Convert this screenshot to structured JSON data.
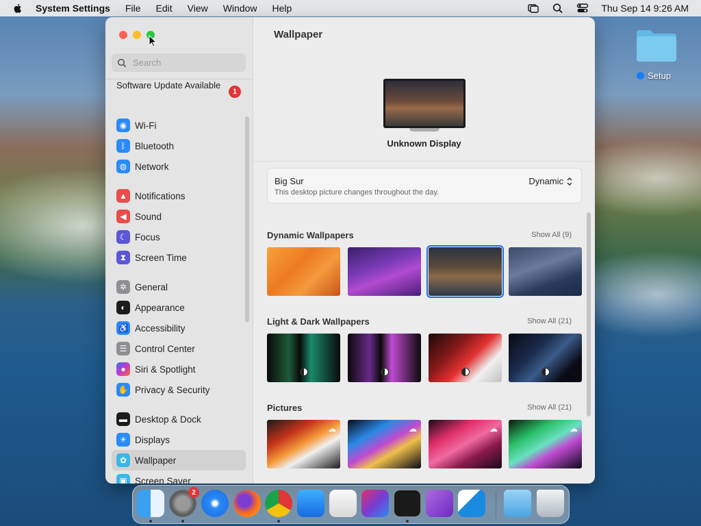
{
  "menubar": {
    "app_name": "System Settings",
    "items": [
      "File",
      "Edit",
      "View",
      "Window",
      "Help"
    ],
    "clock": "Thu Sep 14  9:26 AM"
  },
  "desktop": {
    "folder_label": "Setup"
  },
  "sidebar": {
    "search_placeholder": "Search",
    "update_text": "Software Update Available",
    "update_badge": "1",
    "items": [
      {
        "label": "Wi-Fi",
        "icon": "wifi-icon",
        "color": "#2a8af6"
      },
      {
        "label": "Bluetooth",
        "icon": "bluetooth-icon",
        "color": "#2a8af6"
      },
      {
        "label": "Network",
        "icon": "globe-icon",
        "color": "#2a8af6"
      },
      {
        "label": "Notifications",
        "icon": "bell-icon",
        "color": "#e94c4c"
      },
      {
        "label": "Sound",
        "icon": "speaker-icon",
        "color": "#e94c4c"
      },
      {
        "label": "Focus",
        "icon": "moon-icon",
        "color": "#5b57d6"
      },
      {
        "label": "Screen Time",
        "icon": "hourglass-icon",
        "color": "#5b57d6"
      },
      {
        "label": "General",
        "icon": "gear-icon",
        "color": "#8e8e93"
      },
      {
        "label": "Appearance",
        "icon": "appearance-icon",
        "color": "#1c1c1e"
      },
      {
        "label": "Accessibility",
        "icon": "accessibility-icon",
        "color": "#2a8af6"
      },
      {
        "label": "Control Center",
        "icon": "control-center-icon",
        "color": "#8e8e93"
      },
      {
        "label": "Siri & Spotlight",
        "icon": "siri-icon",
        "color": "#c23ac9"
      },
      {
        "label": "Privacy & Security",
        "icon": "hand-icon",
        "color": "#2a8af6"
      },
      {
        "label": "Desktop & Dock",
        "icon": "dock-icon",
        "color": "#1c1c1e"
      },
      {
        "label": "Displays",
        "icon": "sun-icon",
        "color": "#2a8af6"
      },
      {
        "label": "Wallpaper",
        "icon": "wallpaper-icon",
        "color": "#39b7e6"
      },
      {
        "label": "Screen Saver",
        "icon": "screen-saver-icon",
        "color": "#39b7e6"
      }
    ]
  },
  "main": {
    "title": "Wallpaper",
    "display_name": "Unknown Display",
    "current": {
      "name": "Big Sur",
      "description": "This desktop picture changes throughout the day.",
      "mode": "Dynamic"
    },
    "sections": [
      {
        "title": "Dynamic Wallpapers",
        "show_all": "Show All (9)"
      },
      {
        "title": "Light & Dark Wallpapers",
        "show_all": "Show All (21)"
      },
      {
        "title": "Pictures",
        "show_all": "Show All (21)"
      }
    ]
  },
  "dock": {
    "settings_badge": "2",
    "apps": [
      "Finder",
      "System Settings",
      "Safari",
      "Firefox",
      "Chrome",
      "App Store",
      "TextEdit",
      "Shortcuts",
      "Activity Monitor",
      "Visual Studio",
      "VS Code",
      "Downloads",
      "Trash"
    ]
  }
}
